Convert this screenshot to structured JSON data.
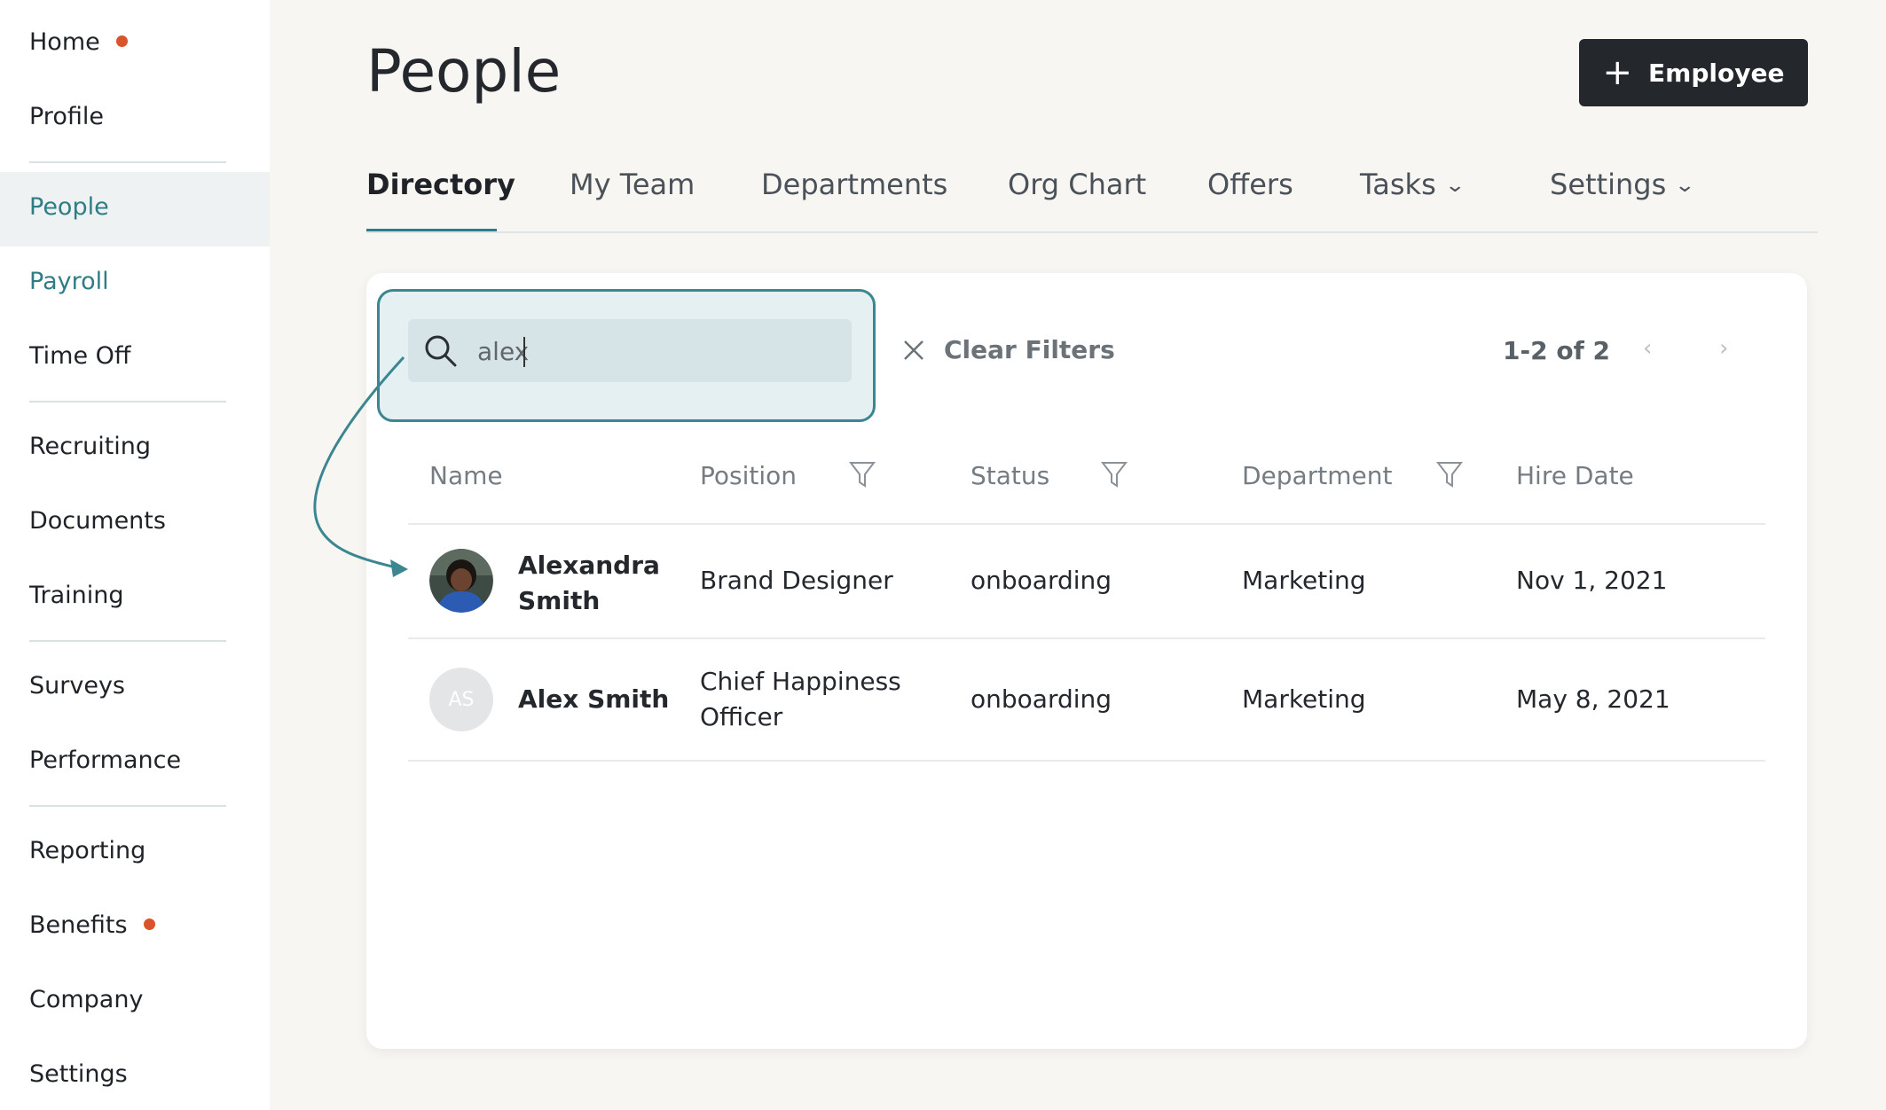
{
  "sidebar": {
    "items": [
      {
        "label": "Home"
      },
      {
        "label": "Profile"
      },
      {
        "label": "People"
      },
      {
        "label": "Payroll"
      },
      {
        "label": "Time Off"
      },
      {
        "label": "Recruiting"
      },
      {
        "label": "Documents"
      },
      {
        "label": "Training"
      },
      {
        "label": "Surveys"
      },
      {
        "label": "Performance"
      },
      {
        "label": "Reporting"
      },
      {
        "label": "Benefits"
      },
      {
        "label": "Company"
      },
      {
        "label": "Settings"
      }
    ],
    "accent_active": "#2e7d86",
    "notification_color": "#d9542b"
  },
  "header": {
    "title": "People",
    "add_button_label": "Employee"
  },
  "tabs": [
    {
      "label": "Directory"
    },
    {
      "label": "My Team"
    },
    {
      "label": "Departments"
    },
    {
      "label": "Org Chart"
    },
    {
      "label": "Offers"
    },
    {
      "label": "Tasks"
    },
    {
      "label": "Settings"
    }
  ],
  "toolbar": {
    "search_value": "alex",
    "clear_filters_label": "Clear Filters",
    "pagination_text": "1-2 of 2"
  },
  "table": {
    "columns": [
      "Name",
      "Position",
      "Status",
      "Department",
      "Hire Date"
    ],
    "rows": [
      {
        "name": [
          "Alexandra",
          "Smith"
        ],
        "position": [
          "Brand Designer"
        ],
        "status": "onboarding",
        "department": "Marketing",
        "hire_date": "Nov 1, 2021"
      },
      {
        "name": [
          "Alex Smith"
        ],
        "initials": "AS",
        "position": [
          "Chief Happiness",
          "Officer"
        ],
        "status": "onboarding",
        "department": "Marketing",
        "hire_date": "May 8, 2021"
      }
    ]
  },
  "colors": {
    "primary_button": "#24282d",
    "highlight_border": "#3b8690",
    "highlight_fill": "#e4f0f2"
  }
}
